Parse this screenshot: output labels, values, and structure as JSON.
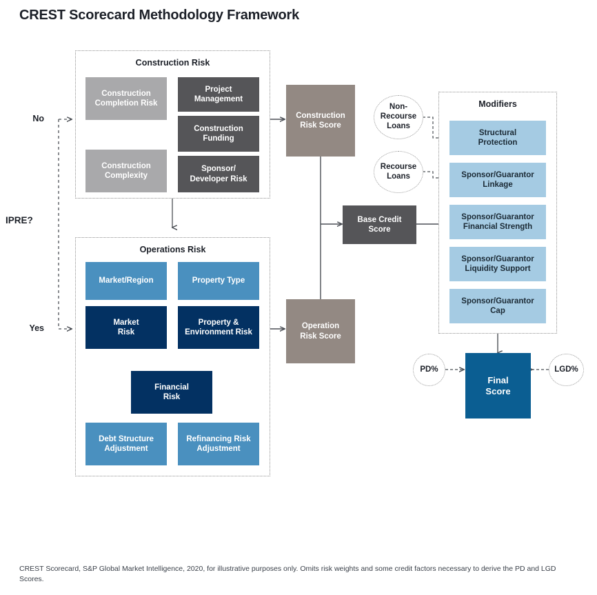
{
  "page": {
    "title": "CREST Scorecard Methodology Framework",
    "footnote": "CREST Scorecard, S&P Global Market Intelligence, 2020, for illustrative purposes only. Omits risk weights and some credit factors necessary to derive the PD and LGD Scores."
  },
  "decision": {
    "question": "IPRE?",
    "no_label": "No",
    "yes_label": "Yes"
  },
  "construction_group": {
    "title": "Construction Risk",
    "boxes": [
      {
        "label": "Construction Completion Risk",
        "line1": "Construction",
        "line2": "Completion Risk",
        "color": "#a9a9ab"
      },
      {
        "label": "Project Management",
        "line1": "Project",
        "line2": "Management",
        "color": "#555558"
      },
      {
        "label": "Construction Funding",
        "line1": "Construction",
        "line2": "Funding",
        "color": "#555558"
      },
      {
        "label": "Construction Complexity",
        "line1": "Construction",
        "line2": "Complexity",
        "color": "#a9a9ab"
      },
      {
        "label": "Sponsor/Developer Risk",
        "line1": "Sponsor/",
        "line2": "Developer Risk",
        "color": "#555558"
      }
    ]
  },
  "operations_group": {
    "title": "Operations Risk",
    "boxes": [
      {
        "label": "Market/Region",
        "line1": "Market/Region",
        "line2": "",
        "color": "#4a90bf"
      },
      {
        "label": "Property Type",
        "line1": "Property Type",
        "line2": "",
        "color": "#4a90bf"
      },
      {
        "label": "Market Risk",
        "line1": "Market",
        "line2": "Risk",
        "color": "#033162"
      },
      {
        "label": "Property & Environment Risk",
        "line1": "Property &",
        "line2": "Environment Risk",
        "color": "#033162"
      },
      {
        "label": "Financial Risk",
        "line1": "Financial",
        "line2": "Risk",
        "color": "#033162"
      },
      {
        "label": "Debt Structure Adjustment",
        "line1": "Debt Structure",
        "line2": "Adjustment",
        "color": "#4a90bf"
      },
      {
        "label": "Refinancing Risk Adjustment",
        "line1": "Refinancing Risk",
        "line2": "Adjustment",
        "color": "#4a90bf"
      }
    ]
  },
  "scores": {
    "construction": {
      "line1": "Construction",
      "line2": "Risk Score",
      "color": "#938983"
    },
    "operation": {
      "line1": "Operation",
      "line2": "Risk Score",
      "color": "#938983"
    },
    "base_credit": {
      "line1": "Base Credit",
      "line2": "Score",
      "color": "#555558"
    },
    "final": {
      "line1": "Final",
      "line2": "Score",
      "color": "#0b5e92"
    }
  },
  "loan_types": [
    {
      "line1": "Non-",
      "line2": "Recourse",
      "line3": "Loans"
    },
    {
      "line1": "Recourse",
      "line2": "Loans",
      "line3": ""
    }
  ],
  "modifiers_group": {
    "title": "Modifiers",
    "boxes": [
      {
        "label": "Structural Protection",
        "line1": "Structural",
        "line2": "Protection"
      },
      {
        "label": "Sponsor/Guarantor Linkage",
        "line1": "Sponsor/Guarantor",
        "line2": "Linkage"
      },
      {
        "label": "Sponsor/Guarantor Financial Strength",
        "line1": "Sponsor/Guarantor",
        "line2": "Financial Strength"
      },
      {
        "label": "Sponsor/Guarantor Liquidity Support",
        "line1": "Sponsor/Guarantor",
        "line2": "Liquidity Support"
      },
      {
        "label": "Sponsor/Guarantor Cap",
        "line1": "Sponsor/Guarantor",
        "line2": "Cap"
      }
    ],
    "color": "#a5cbe3"
  },
  "rate_nodes": {
    "pd": "PD%",
    "lgd": "LGD%"
  },
  "palette": {
    "gray": "#a9a9ab",
    "dark_gray": "#555558",
    "taupe": "#938983",
    "mid_blue": "#4a90bf",
    "navy": "#033162",
    "light_blue": "#a5cbe3",
    "final_blue": "#0b5e92",
    "dashed_border": "#8e8e8e"
  }
}
